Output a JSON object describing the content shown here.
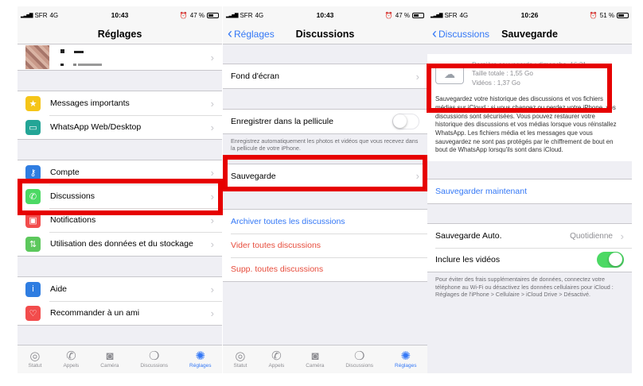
{
  "status": {
    "s1": {
      "carrier": "SFR",
      "network": "4G",
      "time": "10:43",
      "battery": "47 %"
    },
    "s2": {
      "carrier": "SFR",
      "network": "4G",
      "time": "10:43",
      "battery": "47 %"
    },
    "s3": {
      "carrier": "SFR",
      "network": "4G",
      "time": "10:26",
      "battery": "51 %"
    }
  },
  "screen1": {
    "title": "Réglages",
    "group1": [
      {
        "label": "Messages importants",
        "icon": "star-icon",
        "color": "#f5c518"
      },
      {
        "label": "WhatsApp Web/Desktop",
        "icon": "laptop-icon",
        "color": "#23a596"
      }
    ],
    "group2": [
      {
        "label": "Compte",
        "icon": "key-icon",
        "color": "#2f7de1"
      },
      {
        "label": "Discussions",
        "icon": "whatsapp-icon",
        "color": "#4cd964"
      },
      {
        "label": "Notifications",
        "icon": "notification-icon",
        "color": "#f24c4c"
      },
      {
        "label": "Utilisation des données et du stockage",
        "icon": "data-arrows-icon",
        "color": "#5cc85c"
      }
    ],
    "group3": [
      {
        "label": "Aide",
        "icon": "info-icon",
        "color": "#2f7de1"
      },
      {
        "label": "Recommander à un ami",
        "icon": "heart-icon",
        "color": "#f24c4c"
      }
    ]
  },
  "screen2": {
    "back": "Réglages",
    "title": "Discussions",
    "wallpaper": "Fond d'écran",
    "save_to_roll": "Enregistrer dans la pellicule",
    "save_note": "Enregistrez automatiquement les photos et vidéos que vous recevez dans la pellicule de votre iPhone.",
    "backup": "Sauvegarde",
    "archive_all": "Archiver toutes les discussions",
    "clear_all": "Vider toutes discussions",
    "delete_all": "Supp. toutes discussions"
  },
  "screen3": {
    "back": "Discussions",
    "title": "Sauvegarde",
    "last_backup": "Dernière sauvegarde : dimanche, 16:21",
    "total_size": "Taille totale : 1,55 Go",
    "videos": "Vidéos : 1,37 Go",
    "description": "Sauvegardez votre historique des discussions et vos fichiers médias sur iCloud ; si vous changez ou perdez votre iPhone, vos discussions sont sécurisées. Vous pouvez restaurer votre historique des discussions et vos médias lorsque vous réinstallez WhatsApp. Les fichiers média et les messages que vous sauvegardez ne sont pas protégés par le chiffrement de bout en bout de WhatsApp lorsqu'ils sont dans iCloud.",
    "backup_now": "Sauvegarder maintenant",
    "auto_backup": "Sauvegarde Auto.",
    "auto_backup_value": "Quotidienne",
    "include_videos": "Inclure les vidéos",
    "footer": "Pour éviter des frais supplémentaires de données, connectez votre téléphone au Wi-Fi ou désactivez les données cellulaires pour iCloud : Réglages de l'iPhone > Cellulaire > iCloud Drive > Désactivé."
  },
  "tabs": [
    {
      "label": "Statut",
      "icon": "status-icon"
    },
    {
      "label": "Appels",
      "icon": "phone-icon"
    },
    {
      "label": "Caméra",
      "icon": "camera-icon"
    },
    {
      "label": "Discussions",
      "icon": "chat-icon"
    },
    {
      "label": "Réglages",
      "icon": "gear-icon"
    }
  ],
  "accent": "#3478f6",
  "highlight_color": "#e60000"
}
